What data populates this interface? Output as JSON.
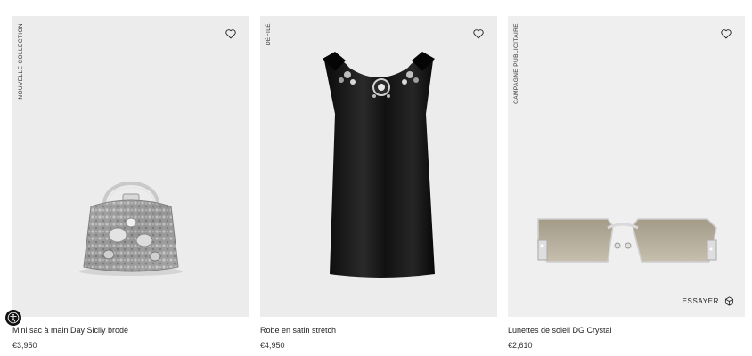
{
  "products": [
    {
      "tag": "NOUVELLE COLLECTION",
      "name": "Mini sac à main Day Sicily brodé",
      "price": "€3,950",
      "icon": "heart-outline-icon"
    },
    {
      "tag": "DÉFILÉ",
      "name": "Robe en satin stretch",
      "price": "€4,950",
      "icon": "heart-outline-icon"
    },
    {
      "tag": "CAMPAGNE PUBLICITAIRE",
      "name": "Lunettes de soleil DG Crystal",
      "price": "€2,610",
      "icon": "heart-outline-icon",
      "try_on_label": "ESSAYER"
    }
  ],
  "accessibility": {
    "icon": "accessibility-icon"
  },
  "colors": {
    "card_bg": "#ececec",
    "text": "#222222",
    "accessibility_bg": "#111111"
  }
}
